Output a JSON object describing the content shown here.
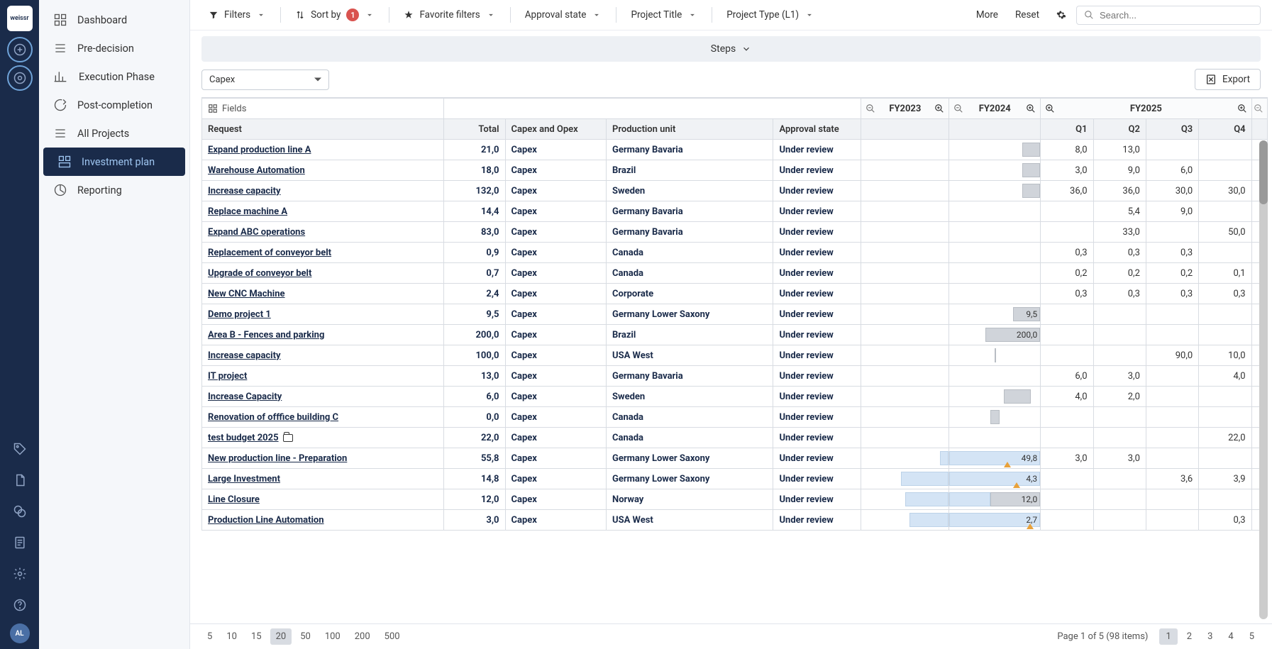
{
  "brand": "weissr",
  "avatar": "AL",
  "sidebar": {
    "items": [
      {
        "label": "Dashboard"
      },
      {
        "label": "Pre-decision"
      },
      {
        "label": "Execution Phase"
      },
      {
        "label": "Post-completion"
      },
      {
        "label": "All Projects"
      },
      {
        "label": "Investment plan"
      },
      {
        "label": "Reporting"
      }
    ]
  },
  "toolbar": {
    "filters": "Filters",
    "sortby": "Sort by",
    "sortby_badge": "1",
    "favorite": "Favorite filters",
    "approval": "Approval state",
    "title": "Project Title",
    "type": "Project Type (L1)",
    "more": "More",
    "reset": "Reset",
    "search_placeholder": "Search..."
  },
  "steps": "Steps",
  "subbar": {
    "select": "Capex",
    "export": "Export"
  },
  "headers": {
    "fields": "Fields",
    "request": "Request",
    "total": "Total",
    "capex": "Capex and Opex",
    "prod": "Production unit",
    "approval": "Approval state",
    "fy23": "FY2023",
    "fy24": "FY2024",
    "fy25": "FY2025",
    "q1": "Q1",
    "q2": "Q2",
    "q3": "Q3",
    "q4": "Q4"
  },
  "rows": [
    {
      "req": "Expand production line A",
      "total": "21,0",
      "cap": "Capex",
      "prod": "Germany Bavaria",
      "app": "Under review",
      "q1": "8,0",
      "q2": "13,0",
      "q3": "",
      "q4": ""
    },
    {
      "req": "Warehouse Automation",
      "total": "18,0",
      "cap": "Capex",
      "prod": "Brazil",
      "app": "Under review",
      "q1": "3,0",
      "q2": "9,0",
      "q3": "6,0",
      "q4": ""
    },
    {
      "req": "Increase capacity",
      "total": "132,0",
      "cap": "Capex",
      "prod": "Sweden",
      "app": "Under review",
      "q1": "36,0",
      "q2": "36,0",
      "q3": "30,0",
      "q4": "30,0"
    },
    {
      "req": "Replace machine A",
      "total": "14,4",
      "cap": "Capex",
      "prod": "Germany Bavaria",
      "app": "Under review",
      "q1": "",
      "q2": "5,4",
      "q3": "9,0",
      "q4": ""
    },
    {
      "req": "Expand ABC operations",
      "total": "83,0",
      "cap": "Capex",
      "prod": "Germany Bavaria",
      "app": "Under review",
      "q1": "",
      "q2": "33,0",
      "q3": "",
      "q4": "50,0"
    },
    {
      "req": "Replacement of conveyor belt",
      "total": "0,9",
      "cap": "Capex",
      "prod": "Canada",
      "app": "Under review",
      "q1": "0,3",
      "q2": "0,3",
      "q3": "0,3",
      "q4": ""
    },
    {
      "req": "Upgrade of conveyor belt",
      "total": "0,7",
      "cap": "Capex",
      "prod": "Canada",
      "app": "Under review",
      "q1": "0,2",
      "q2": "0,2",
      "q3": "0,2",
      "q4": "0,1"
    },
    {
      "req": "New CNC Machine",
      "total": "2,4",
      "cap": "Capex",
      "prod": "Corporate",
      "app": "Under review",
      "q1": "0,3",
      "q2": "0,3",
      "q3": "0,3",
      "q4": "0,3"
    },
    {
      "req": "Demo project 1",
      "total": "9,5",
      "cap": "Capex",
      "prod": "Germany Lower Saxony",
      "app": "Under review",
      "fy24": "9,5",
      "q1": "",
      "q2": "",
      "q3": "",
      "q4": ""
    },
    {
      "req": "Area B - Fences and parking",
      "total": "200,0",
      "cap": "Capex",
      "prod": "Brazil",
      "app": "Under review",
      "fy24": "200,0",
      "q1": "",
      "q2": "",
      "q3": "",
      "q4": ""
    },
    {
      "req": "Increase capacity",
      "total": "100,0",
      "cap": "Capex",
      "prod": "USA West",
      "app": "Under review",
      "q1": "",
      "q2": "",
      "q3": "90,0",
      "q4": "10,0"
    },
    {
      "req": "IT project",
      "total": "13,0",
      "cap": "Capex",
      "prod": "Germany Bavaria",
      "app": "Under review",
      "q1": "6,0",
      "q2": "3,0",
      "q3": "",
      "q4": "4,0"
    },
    {
      "req": "Increase Capacity",
      "total": "6,0",
      "cap": "Capex",
      "prod": "Sweden",
      "app": "Under review",
      "q1": "4,0",
      "q2": "2,0",
      "q3": "",
      "q4": ""
    },
    {
      "req": "Renovation of offfice building C",
      "total": "0,0",
      "cap": "Capex",
      "prod": "Canada",
      "app": "Under review",
      "q1": "",
      "q2": "",
      "q3": "",
      "q4": ""
    },
    {
      "req": "test budget 2025",
      "total": "22,0",
      "cap": "Capex",
      "prod": "Canada",
      "app": "Under review",
      "q1": "",
      "q2": "",
      "q3": "",
      "q4": "22,0",
      "folder": true
    },
    {
      "req": "New production line - Preparation",
      "total": "55,8",
      "cap": "Capex",
      "prod": "Germany Lower Saxony",
      "app": "Under review",
      "fy24": "49,8",
      "q1": "3,0",
      "q2": "3,0",
      "q3": "",
      "q4": ""
    },
    {
      "req": "Large Investment",
      "total": "14,8",
      "cap": "Capex",
      "prod": "Germany Lower Saxony",
      "app": "Under review",
      "fy24": "4,3",
      "q1": "",
      "q2": "",
      "q3": "3,6",
      "q4": "3,9"
    },
    {
      "req": "Line Closure",
      "total": "12,0",
      "cap": "Capex",
      "prod": "Norway",
      "app": "Under review",
      "fy24": "12,0",
      "q1": "",
      "q2": "",
      "q3": "",
      "q4": ""
    },
    {
      "req": "Production Line Automation",
      "total": "3,0",
      "cap": "Capex",
      "prod": "USA West",
      "app": "Under review",
      "fy24": "2,7",
      "q1": "",
      "q2": "",
      "q3": "",
      "q4": "0,3"
    }
  ],
  "footer": {
    "sizes": [
      "5",
      "10",
      "15",
      "20",
      "50",
      "100",
      "200",
      "500"
    ],
    "active_size": "20",
    "info": "Page 1 of 5 (98 items)",
    "pages": [
      "1",
      "2",
      "3",
      "4",
      "5"
    ],
    "active_page": "1"
  }
}
